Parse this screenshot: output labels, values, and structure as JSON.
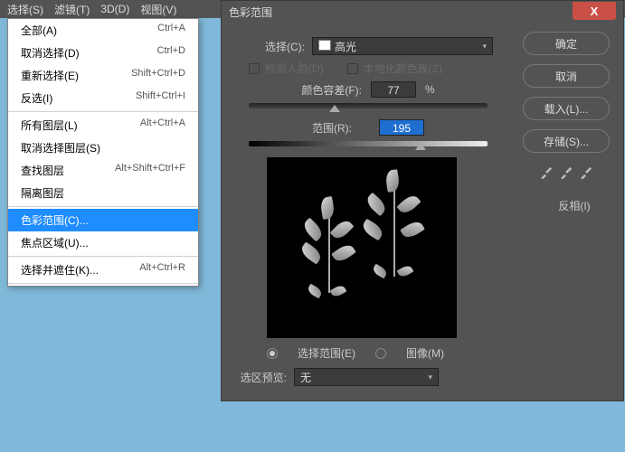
{
  "menubar": {
    "select": "选择(S)",
    "filter": "滤镜(T)",
    "threed": "3D(D)",
    "view": "视图(V)"
  },
  "menu": {
    "all": "全部(A)",
    "all_s": "Ctrl+A",
    "deselect": "取消选择(D)",
    "deselect_s": "Ctrl+D",
    "reselect": "重新选择(E)",
    "reselect_s": "Shift+Ctrl+D",
    "inverse": "反选(I)",
    "inverse_s": "Shift+Ctrl+I",
    "alllayers": "所有图层(L)",
    "alllayers_s": "Alt+Ctrl+A",
    "deslayers": "取消选择图层(S)",
    "findlayers": "查找图层",
    "findlayers_s": "Alt+Shift+Ctrl+F",
    "isolayers": "隔离图层",
    "colorrange": "色彩范围(C)...",
    "focusarea": "焦点区域(U)...",
    "selectmask": "选择并遮住(K)...",
    "selectmask_s": "Alt+Ctrl+R"
  },
  "dialog": {
    "title": "色彩范围",
    "select_label": "选择(C):",
    "select_value": "高光",
    "detect_faces": "检测人脸(D)",
    "localized": "本地化颜色簇(Z)",
    "fuzz_label": "颜色容差(F):",
    "fuzz_val": "77",
    "pct": "%",
    "range_label": "范围(R):",
    "range_val": "195",
    "radio_sel": "选择范围(E)",
    "radio_img": "图像(M)",
    "prev_label": "选区预览:",
    "prev_value": "无",
    "ok": "确定",
    "cancel": "取消",
    "load": "载入(L)...",
    "save": "存储(S)...",
    "invert": "反相(I)"
  }
}
